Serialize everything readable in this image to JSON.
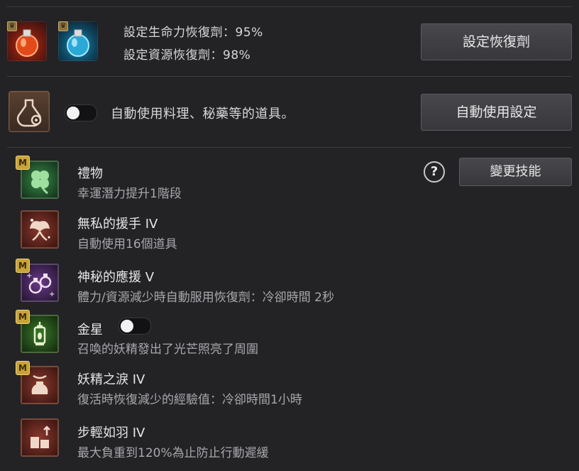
{
  "potions": {
    "hp_label": "設定生命力恢復劑：95%",
    "mp_label": "設定資源恢復劑：98%",
    "hp_icon": "red-potion-icon",
    "mp_icon": "blue-potion-icon",
    "button_label": "設定恢復劑"
  },
  "auto_use": {
    "icon": "potion-gear-icon",
    "label": "自動使用料理、秘藥等的道具。",
    "toggle_on": false,
    "button_label": "自動使用設定"
  },
  "skills_panel": {
    "help_label": "?",
    "change_button_label": "變更技能",
    "badge_label": "M",
    "skills": [
      {
        "name": "禮物",
        "desc": "幸運潛力提升1階段",
        "icon": "clover-icon",
        "badge": true,
        "color": "#2f6b3a"
      },
      {
        "name": "無私的援手 IV",
        "desc": "自動使用16個道具",
        "icon": "fairy-icon",
        "badge": false,
        "color": "#6b2a22"
      },
      {
        "name": "神秘的應援 V",
        "desc": "體力/資源減少時自動服用恢復劑：冷卻時間 2秒",
        "icon": "potions-icon",
        "badge": true,
        "color": "#4a2f66"
      },
      {
        "name": "金星",
        "desc": "召喚的妖精發出了光芒照亮了周圍",
        "icon": "lantern-icon",
        "badge": true,
        "color": "#2e5a22",
        "has_toggle": true
      },
      {
        "name": "妖精之淚 IV",
        "desc": "復活時恢復減少的經驗值：冷卻時間1小時",
        "icon": "vase-icon",
        "badge": true,
        "color": "#6b2a22"
      },
      {
        "name": "步輕如羽 IV",
        "desc": "最大負重到120%為止防止行動遲緩",
        "icon": "weight-icon",
        "badge": false,
        "color": "#6b2a22"
      }
    ]
  }
}
